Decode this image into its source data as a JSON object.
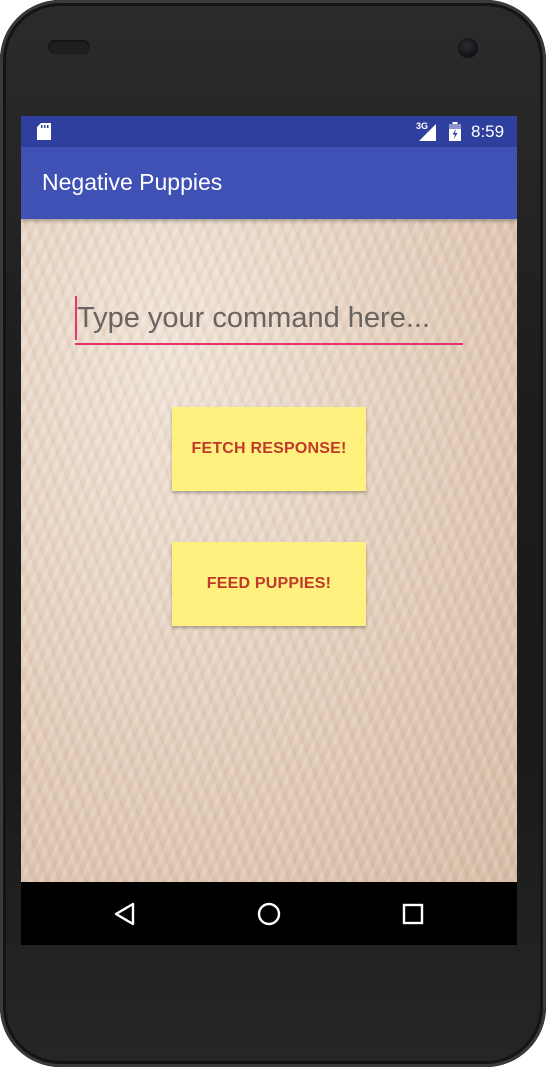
{
  "status_bar": {
    "network_label": "3G",
    "time": "8:59",
    "icons": [
      "sd-card-icon",
      "signal-icon",
      "battery-icon"
    ]
  },
  "app_bar": {
    "title": "Negative Puppies"
  },
  "command_input": {
    "placeholder": "Type your command here...",
    "value": ""
  },
  "buttons": {
    "fetch_label": "FETCH RESPONSE!",
    "feed_label": "FEED PUPPIES!"
  },
  "nav_bar": {
    "icons": [
      "back-icon",
      "home-icon",
      "recent-apps-icon"
    ]
  },
  "colors": {
    "status_bar": "#2f3f9e",
    "app_bar": "#3f51b5",
    "accent": "#e8336d",
    "button_bg": "#fff17f",
    "button_text": "#c0392b"
  }
}
